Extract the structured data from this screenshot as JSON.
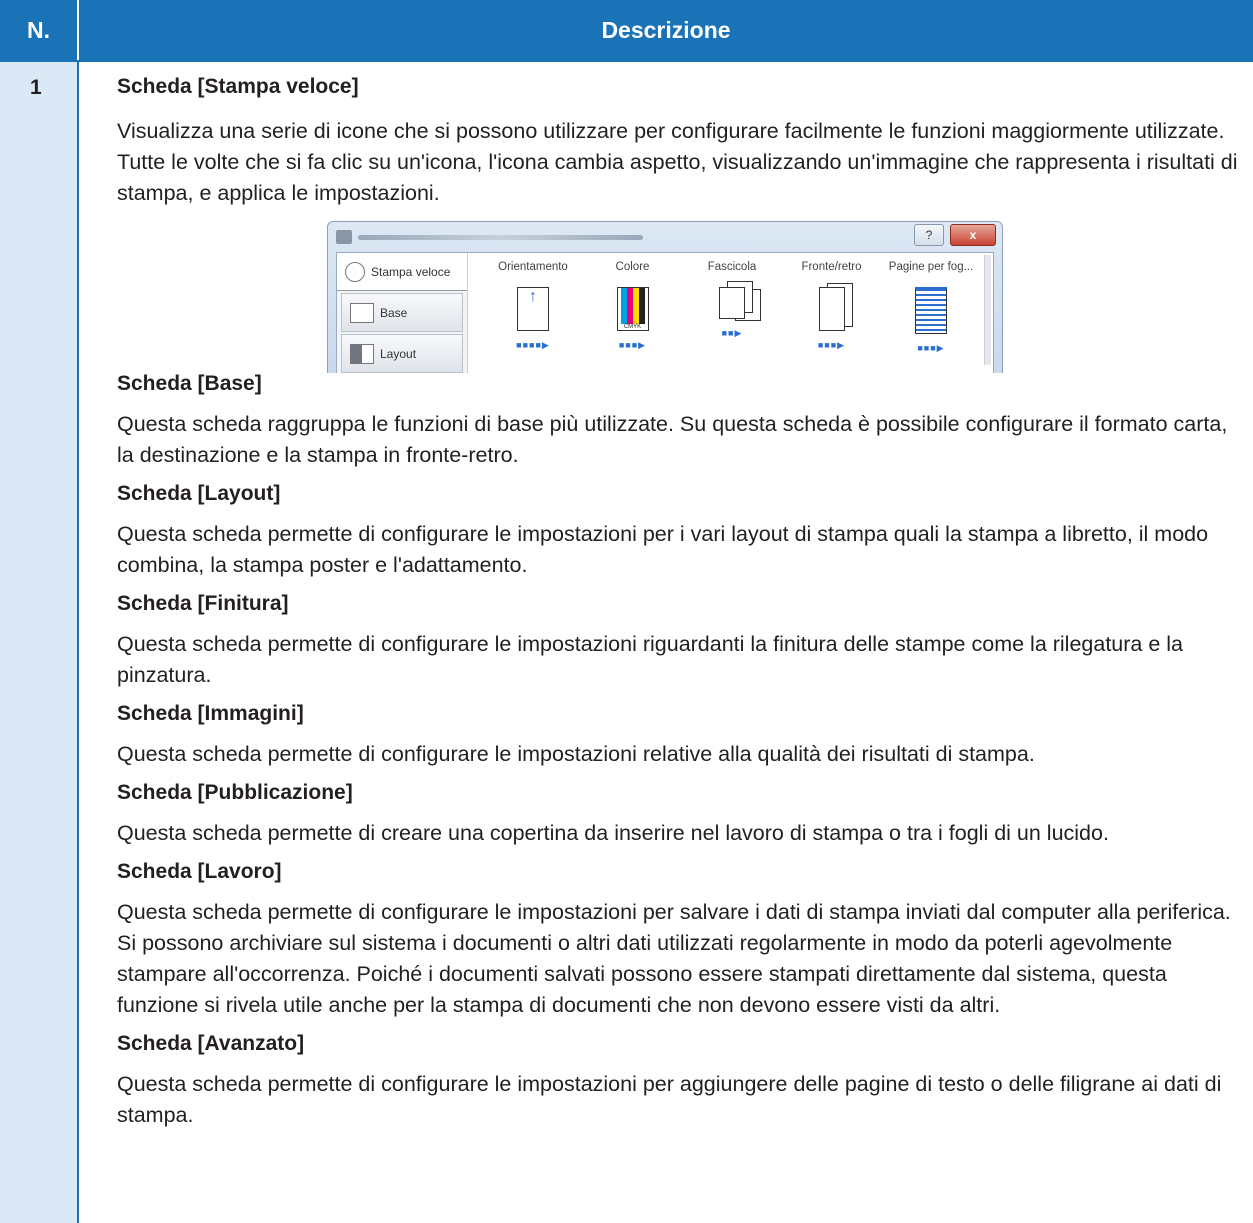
{
  "header": {
    "col_number": "N.",
    "col_description": "Descrizione"
  },
  "row": {
    "number": "1"
  },
  "sections": [
    {
      "title": "Scheda [Stampa veloce]",
      "text": "Visualizza una serie di icone che si possono utilizzare per configurare facilmente le funzioni maggiormente utilizzate. Tutte le volte che si fa clic su un'icona, l'icona cambia aspetto, visualizzando un'immagine che rappresenta i risultati di stampa, e applica le impostazioni."
    },
    {
      "title": "Scheda [Base]",
      "text": "Questa scheda raggruppa le funzioni di base più utilizzate. Su questa scheda è possibile configurare il formato carta, la destinazione e la stampa in fronte-retro."
    },
    {
      "title": "Scheda [Layout]",
      "text": "Questa scheda permette di configurare le impostazioni per i vari layout di stampa quali la stampa a libretto, il modo combina, la stampa poster e l'adattamento."
    },
    {
      "title": "Scheda [Finitura]",
      "text": "Questa scheda permette di configurare le impostazioni riguardanti la finitura delle stampe come la rilegatura e la pinzatura."
    },
    {
      "title": "Scheda [Immagini]",
      "text": "Questa scheda permette di configurare le impostazioni relative alla qualità dei risultati di stampa."
    },
    {
      "title": "Scheda [Pubblicazione]",
      "text": "Questa scheda permette di creare una copertina da inserire nel lavoro di stampa o tra i fogli di un lucido."
    },
    {
      "title": "Scheda [Lavoro]",
      "text": "Questa scheda permette di configurare le impostazioni per salvare i dati di stampa inviati dal computer alla periferica. Si possono archiviare sul sistema i documenti o altri dati utilizzati regolarmente in modo da poterli agevolmente stampare all'occorrenza. Poiché i documenti salvati possono essere stampati direttamente dal sistema, questa funzione si rivela utile anche per la stampa di documenti che non devono essere visti da altri."
    },
    {
      "title": "Scheda [Avanzato]",
      "text": "Questa scheda permette di configurare le impostazioni per aggiungere delle pagine di testo o delle filigrane ai dati di stampa."
    }
  ],
  "dialog": {
    "help_glyph": "?",
    "close_glyph": "x",
    "tabs": [
      "Stampa veloce",
      "Base",
      "Layout"
    ],
    "quick_labels": [
      "Orientamento",
      "Colore",
      "Fascicola",
      "Fronte/retro",
      "Pagine per fog..."
    ],
    "cmyk_text": "CMYK"
  }
}
